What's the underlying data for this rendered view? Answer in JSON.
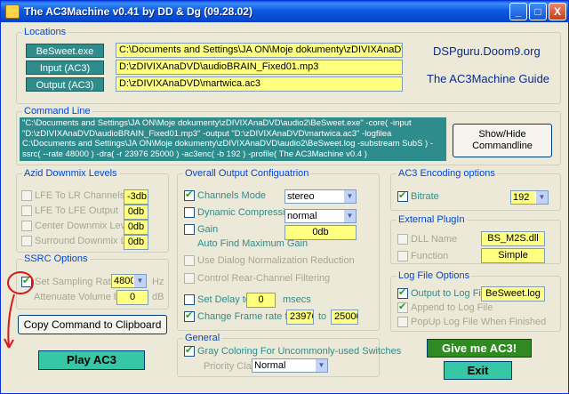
{
  "window": {
    "title": "The AC3Machine v0.41 by DD & Dg (09.28.02)",
    "controls": [
      "_",
      "□",
      "X"
    ]
  },
  "locations": {
    "legend": "Locations",
    "besweet_label": "BeSweet.exe",
    "besweet_value": "C:\\Documents and Settings\\JA ON\\Moje dokumenty\\zDIVIXAnaDVD\\audio2\\BeSw",
    "input_label": "Input (AC3)",
    "input_value": "D:\\zDIVIXAnaDVD\\audioBRAIN_Fixed01.mp3",
    "output_label": "Output (AC3)",
    "output_value": "D:\\zDIVIXAnaDVD\\martwica.ac3",
    "site": "DSPguru.Doom9.org",
    "guide": "The AC3Machine Guide"
  },
  "command": {
    "legend": "Command Line",
    "text": "\"C:\\Documents and Settings\\JA ON\\Moje dokumenty\\zDIVIXAnaDVD\\audio2\\BeSweet.exe\" -core( -input \"D:\\zDIVIXAnaDVD\\audioBRAIN_Fixed01.mp3\" -output \"D:\\zDIVIXAnaDVD\\martwica.ac3\" -logfilea C:\\Documents and Settings\\JA ON\\Moje dokumenty\\zDIVIXAnaDVD\\audio2\\BeSweet.log -substream SubS ) -ssrc( --rate 48000 ) -dra( -r 23976 25000 ) -ac3enc( -b 192 ) -profile( The AC3Machine v0.4 )",
    "toggle_button": "Show/Hide Commandline"
  },
  "downmix": {
    "legend": "Azid Downmix Levels",
    "items": [
      {
        "label": "LFE To LR Channels",
        "value": "-3db"
      },
      {
        "label": "LFE To LFE Output",
        "value": "0db"
      },
      {
        "label": "Center Downmix Level",
        "value": "0db"
      },
      {
        "label": "Surround Downmix Level",
        "value": "0db"
      }
    ]
  },
  "ssrc": {
    "legend": "SSRC Options",
    "set_rate_label": "Set Sampling Rate to",
    "rate_value": "48000",
    "rate_unit": "Hz",
    "attenuate_label": "Attenuate Volume by",
    "attenuate_value": "0",
    "attenuate_unit": "dB"
  },
  "copy_button": "Copy Command to Clipboard",
  "play_button": "Play AC3",
  "overall": {
    "legend": "Overall Output Configuatrion",
    "channels_label": "Channels Mode",
    "channels_value": "stereo",
    "dynamic_label": "Dynamic Compression",
    "dynamic_value": "normal",
    "gain_label": "Gain",
    "gain_value": "0db",
    "auto_gain_label": "Auto Find Maximum Gain",
    "dialog_label": "Use Dialog Normalization Reduction",
    "rear_label": "Control Rear-Channel Filtering",
    "delay_label": "Set Delay to",
    "delay_value": "0",
    "delay_unit": "msecs",
    "frame_label": "Change Frame rate from",
    "frame_from": "23976",
    "frame_to_label": "to",
    "frame_to": "25000"
  },
  "general": {
    "legend": "General",
    "gray_label": "Gray Coloring For Uncommonly-used Switches",
    "priority_label": "Priority Class",
    "priority_value": "Normal"
  },
  "encoding": {
    "legend": "AC3 Encoding options",
    "bitrate_label": "Bitrate",
    "bitrate_value": "192"
  },
  "plugin": {
    "legend": "External PlugIn",
    "dll_label": "DLL Name",
    "dll_value": "BS_M2S.dll",
    "function_label": "Function",
    "function_value": "Simple"
  },
  "logfile": {
    "legend": "Log File Options",
    "output_label": "Output to Log File",
    "output_value": "BeSweet.log",
    "append_label": "Append to Log File",
    "popup_label": "PopUp Log File When Finished"
  },
  "give_button": "Give me AC3!",
  "exit_button": "Exit"
}
